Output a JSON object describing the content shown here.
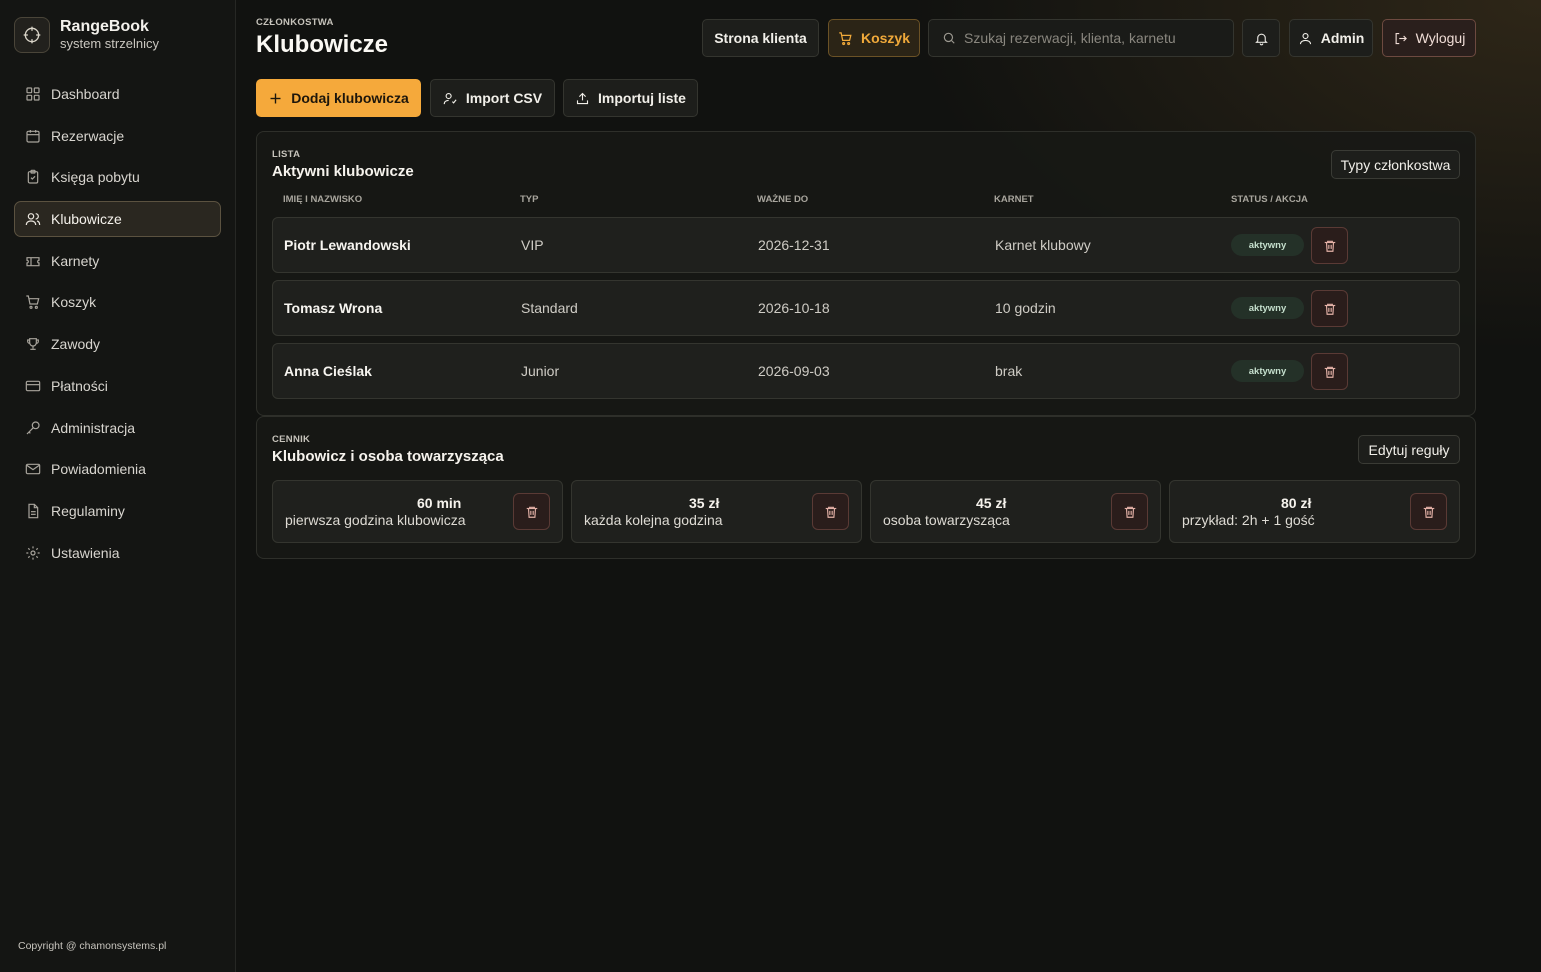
{
  "brand": {
    "name": "RangeBook",
    "subtitle": "system strzelnicy",
    "logo_icon": "crosshair-icon"
  },
  "sidebar": {
    "items": [
      {
        "label": "Dashboard",
        "icon": "grid-icon",
        "active": false
      },
      {
        "label": "Rezerwacje",
        "icon": "calendar-icon",
        "active": false
      },
      {
        "label": "Księga pobytu",
        "icon": "clipboard-icon",
        "active": false
      },
      {
        "label": "Klubowicze",
        "icon": "users-icon",
        "active": true
      },
      {
        "label": "Karnety",
        "icon": "ticket-icon",
        "active": false
      },
      {
        "label": "Koszyk",
        "icon": "cart-icon",
        "active": false
      },
      {
        "label": "Zawody",
        "icon": "trophy-icon",
        "active": false
      },
      {
        "label": "Płatności",
        "icon": "card-icon",
        "active": false
      },
      {
        "label": "Administracja",
        "icon": "key-icon",
        "active": false
      },
      {
        "label": "Powiadomienia",
        "icon": "mail-icon",
        "active": false
      },
      {
        "label": "Regulaminy",
        "icon": "document-icon",
        "active": false
      },
      {
        "label": "Ustawienia",
        "icon": "gear-icon",
        "active": false
      }
    ],
    "copyright": "Copyright @ chamonsystems.pl"
  },
  "header": {
    "eyebrow": "CZŁONKOSTWA",
    "title": "Klubowicze",
    "client_page_label": "Strona klienta",
    "cart_label": "Koszyk",
    "search_placeholder": "Szukaj rezerwacji, klienta, karnetu",
    "admin_label": "Admin",
    "logout_label": "Wyloguj"
  },
  "actions": {
    "add_label": "Dodaj klubowicza",
    "import_csv_label": "Import CSV",
    "import_list_label": "Importuj liste"
  },
  "members": {
    "eyebrow": "LISTA",
    "title": "Aktywni klubowicze",
    "types_button": "Typy członkostwa",
    "columns": [
      "IMIĘ I NAZWISKO",
      "TYP",
      "WAŻNE DO",
      "KARNET",
      "STATUS / AKCJA"
    ],
    "rows": [
      {
        "name": "Piotr Lewandowski",
        "type": "VIP",
        "valid_until": "2026-12-31",
        "pass": "Karnet klubowy",
        "status": "aktywny"
      },
      {
        "name": "Tomasz Wrona",
        "type": "Standard",
        "valid_until": "2026-10-18",
        "pass": "10 godzin",
        "status": "aktywny"
      },
      {
        "name": "Anna Cieślak",
        "type": "Junior",
        "valid_until": "2026-09-03",
        "pass": "brak",
        "status": "aktywny"
      }
    ]
  },
  "pricing": {
    "eyebrow": "CENNIK",
    "title": "Klubowicz i osoba towarzysząca",
    "edit_button": "Edytuj reguły",
    "items": [
      {
        "value": "60 min",
        "desc": "pierwsza godzina klubowicza"
      },
      {
        "value": "35 zł",
        "desc": "każda kolejna godzina"
      },
      {
        "value": "45 zł",
        "desc": "osoba towarzysząca"
      },
      {
        "value": "80 zł",
        "desc": "przykład: 2h + 1 gość"
      }
    ]
  },
  "colors": {
    "accent": "#f5a93b",
    "background": "#111210",
    "status_active_bg": "#243128",
    "danger_border": "#5a3a35"
  }
}
